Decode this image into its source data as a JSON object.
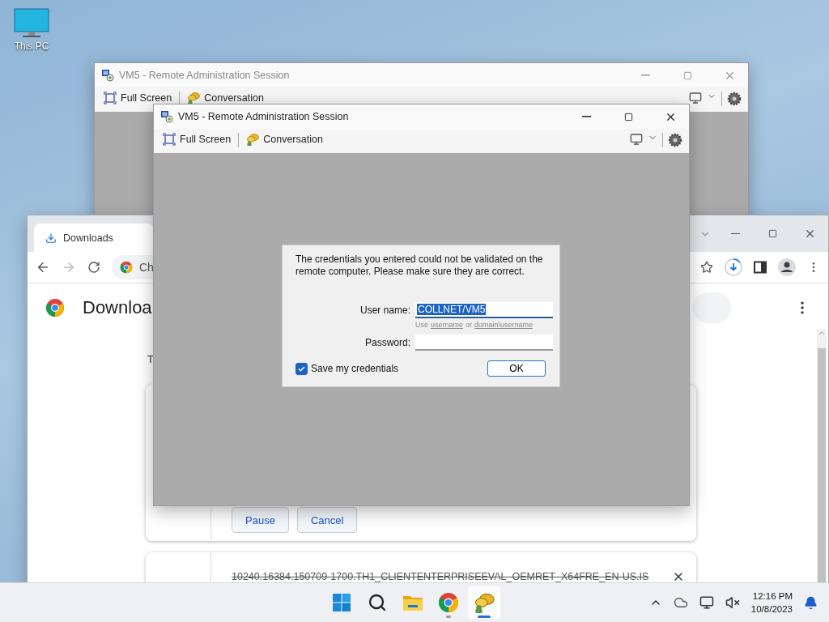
{
  "desktop_icons": [
    {
      "label": "This PC"
    }
  ],
  "back_session": {
    "title": "VM5 - Remote Administration Session",
    "active": false,
    "toolbar": [
      {
        "kind": "fullscreen",
        "label": "Full Screen"
      },
      {
        "kind": "conversation",
        "label": "Conversation"
      }
    ]
  },
  "browser": {
    "tab": {
      "title": "Downloads",
      "selected": true
    },
    "address": "Ch",
    "page_title": "Downloa",
    "section_label": "T",
    "downloads": [
      {
        "kind": "active",
        "buttons": [
          "Pause",
          "Cancel"
        ]
      },
      {
        "kind": "removed",
        "file": "10240.16384.150709-1700.TH1_CLIENTENTERPRISEEVAL_OEMRET_X64FRE_EN-US.IS"
      }
    ]
  },
  "session": {
    "title": "VM5 - Remote Administration Session",
    "active": true,
    "toolbar": [
      {
        "kind": "fullscreen",
        "label": "Full Screen"
      },
      {
        "kind": "conversation",
        "label": "Conversation"
      }
    ],
    "dialog": {
      "message": "The credentials you entered could not be validated on the remote computer. Please make sure they are correct.",
      "username_label": "User name:",
      "username": {
        "value": "COLLNET/VM5",
        "selected": true
      },
      "hint": {
        "lead": "Use",
        "link_1": "username",
        "join": "or",
        "link_2": "domain\\username"
      },
      "password_label": "Password:",
      "save_credentials": {
        "label": "Save my credentials",
        "checked": true
      },
      "ok": "OK"
    }
  },
  "taskbar": {
    "apps": [
      {
        "kind": "start",
        "selected": false,
        "running": false
      },
      {
        "kind": "search",
        "selected": false,
        "running": false
      },
      {
        "kind": "explorer",
        "selected": false,
        "running": false
      },
      {
        "kind": "chrome",
        "selected": false,
        "running": true
      },
      {
        "kind": "chat",
        "selected": true,
        "running": true
      }
    ],
    "time": "12:16 PM",
    "date": "10/8/2023"
  }
}
